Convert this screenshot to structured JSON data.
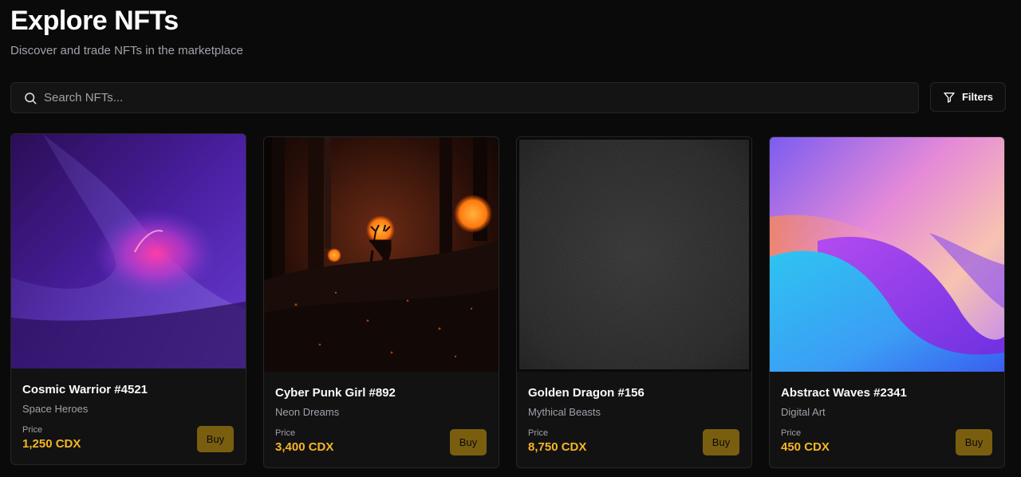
{
  "header": {
    "title": "Explore NFTs",
    "subtitle": "Discover and trade NFTs in the marketplace"
  },
  "search": {
    "icon": "search-icon",
    "placeholder": "Search NFTs..."
  },
  "filters": {
    "icon": "filter-icon",
    "label": "Filters"
  },
  "colors": {
    "accent_price": "#f5b526",
    "buy_button": "#7a5e10",
    "background": "#0a0a0a",
    "card": "#121212"
  },
  "cards": [
    {
      "name": "Cosmic Warrior #4521",
      "collection": "Space Heroes",
      "price_label": "Price",
      "price": "1,250 CDX",
      "buy_label": "Buy"
    },
    {
      "name": "Cyber Punk Girl #892",
      "collection": "Neon Dreams",
      "price_label": "Price",
      "price": "3,400 CDX",
      "buy_label": "Buy"
    },
    {
      "name": "Golden Dragon #156",
      "collection": "Mythical Beasts",
      "price_label": "Price",
      "price": "8,750 CDX",
      "buy_label": "Buy"
    },
    {
      "name": "Abstract Waves #2341",
      "collection": "Digital Art",
      "price_label": "Price",
      "price": "450 CDX",
      "buy_label": "Buy"
    }
  ]
}
